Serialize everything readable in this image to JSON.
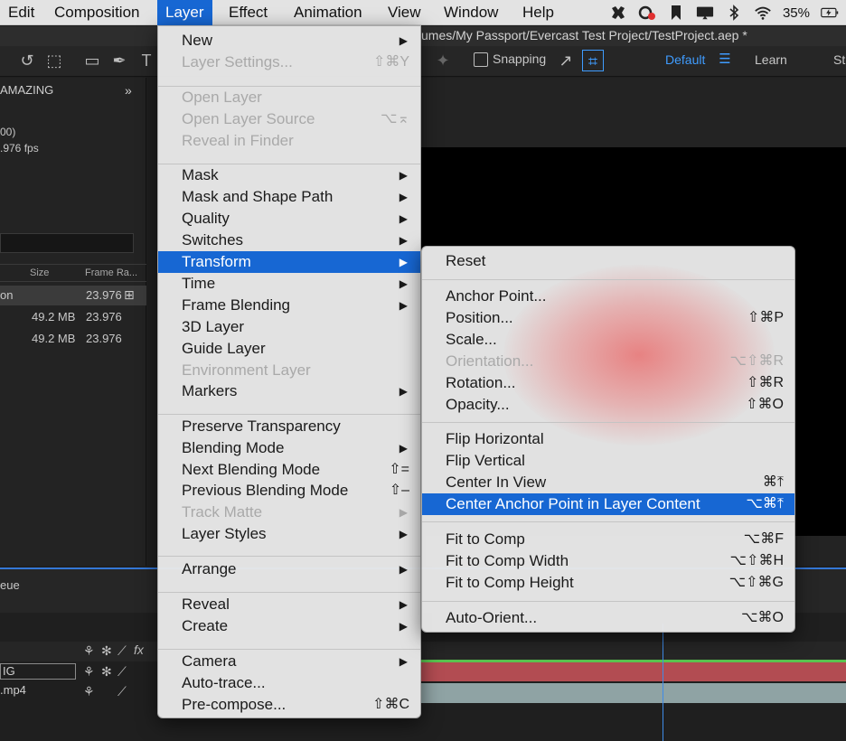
{
  "menubar": {
    "items": [
      "Edit",
      "Composition",
      "Layer",
      "Effect",
      "Animation",
      "View",
      "Window",
      "Help"
    ],
    "battery": "35%"
  },
  "toolbar": {
    "path_title": "umes/My Passport/Evercast Test Project/TestProject.aep *",
    "snapping": "Snapping",
    "workspace_default": "Default",
    "workspace_learn": "Learn",
    "workspace_st": "St"
  },
  "project": {
    "name_fragment": "AMAZING",
    "info_line1": "00)",
    "info_line2": ".976 fps",
    "col_size": "Size",
    "col_frame_rate": "Frame Ra...",
    "rows": [
      {
        "name": "on",
        "size": "",
        "fps": "23.976"
      },
      {
        "name": "",
        "size": "49.2 MB",
        "fps": "23.976"
      },
      {
        "name": "",
        "size": "49.2 MB",
        "fps": "23.976"
      }
    ]
  },
  "lower": {
    "queue_label": "eue",
    "layer1": "IG",
    "layer2": ".mp4"
  },
  "layer_menu": {
    "items": [
      {
        "label": "New",
        "shortcut": "",
        "submenu": true,
        "disabled": false,
        "highlighted": false
      },
      {
        "label": "Layer Settings...",
        "shortcut": "⇧⌘Y",
        "submenu": false,
        "disabled": true,
        "highlighted": false
      },
      {
        "label": "Open Layer",
        "shortcut": "",
        "submenu": false,
        "disabled": true,
        "highlighted": false
      },
      {
        "label": "Open Layer Source",
        "shortcut": "⌥⌅",
        "submenu": false,
        "disabled": true,
        "highlighted": false
      },
      {
        "label": "Reveal in Finder",
        "shortcut": "",
        "submenu": false,
        "disabled": true,
        "highlighted": false
      },
      {
        "label": "Mask",
        "shortcut": "",
        "submenu": true,
        "disabled": false,
        "highlighted": false
      },
      {
        "label": "Mask and Shape Path",
        "shortcut": "",
        "submenu": true,
        "disabled": false,
        "highlighted": false
      },
      {
        "label": "Quality",
        "shortcut": "",
        "submenu": true,
        "disabled": false,
        "highlighted": false
      },
      {
        "label": "Switches",
        "shortcut": "",
        "submenu": true,
        "disabled": false,
        "highlighted": false
      },
      {
        "label": "Transform",
        "shortcut": "",
        "submenu": true,
        "disabled": false,
        "highlighted": true
      },
      {
        "label": "Time",
        "shortcut": "",
        "submenu": true,
        "disabled": false,
        "highlighted": false
      },
      {
        "label": "Frame Blending",
        "shortcut": "",
        "submenu": true,
        "disabled": false,
        "highlighted": false
      },
      {
        "label": "3D Layer",
        "shortcut": "",
        "submenu": false,
        "disabled": false,
        "highlighted": false
      },
      {
        "label": "Guide Layer",
        "shortcut": "",
        "submenu": false,
        "disabled": false,
        "highlighted": false
      },
      {
        "label": "Environment Layer",
        "shortcut": "",
        "submenu": false,
        "disabled": true,
        "highlighted": false
      },
      {
        "label": "Markers",
        "shortcut": "",
        "submenu": true,
        "disabled": false,
        "highlighted": false
      },
      {
        "label": "Preserve Transparency",
        "shortcut": "",
        "submenu": false,
        "disabled": false,
        "highlighted": false
      },
      {
        "label": "Blending Mode",
        "shortcut": "",
        "submenu": true,
        "disabled": false,
        "highlighted": false
      },
      {
        "label": "Next Blending Mode",
        "shortcut": "⇧=",
        "submenu": false,
        "disabled": false,
        "highlighted": false
      },
      {
        "label": "Previous Blending Mode",
        "shortcut": "⇧–",
        "submenu": false,
        "disabled": false,
        "highlighted": false
      },
      {
        "label": "Track Matte",
        "shortcut": "",
        "submenu": true,
        "disabled": true,
        "highlighted": false
      },
      {
        "label": "Layer Styles",
        "shortcut": "",
        "submenu": true,
        "disabled": false,
        "highlighted": false
      },
      {
        "label": "Arrange",
        "shortcut": "",
        "submenu": true,
        "disabled": false,
        "highlighted": false
      },
      {
        "label": "Reveal",
        "shortcut": "",
        "submenu": true,
        "disabled": false,
        "highlighted": false
      },
      {
        "label": "Create",
        "shortcut": "",
        "submenu": true,
        "disabled": false,
        "highlighted": false
      },
      {
        "label": "Camera",
        "shortcut": "",
        "submenu": true,
        "disabled": false,
        "highlighted": false
      },
      {
        "label": "Auto-trace...",
        "shortcut": "",
        "submenu": false,
        "disabled": false,
        "highlighted": false
      },
      {
        "label": "Pre-compose...",
        "shortcut": "⇧⌘C",
        "submenu": false,
        "disabled": false,
        "highlighted": false
      }
    ]
  },
  "transform_menu": {
    "items": [
      {
        "label": "Reset",
        "shortcut": "",
        "disabled": false,
        "highlighted": false
      },
      {
        "label": "Anchor Point...",
        "shortcut": "",
        "disabled": false,
        "highlighted": false
      },
      {
        "label": "Position...",
        "shortcut": "⇧⌘P",
        "disabled": false,
        "highlighted": false
      },
      {
        "label": "Scale...",
        "shortcut": "",
        "disabled": false,
        "highlighted": false
      },
      {
        "label": "Orientation...",
        "shortcut": "⌥⇧⌘R",
        "disabled": true,
        "highlighted": false
      },
      {
        "label": "Rotation...",
        "shortcut": "⇧⌘R",
        "disabled": false,
        "highlighted": false
      },
      {
        "label": "Opacity...",
        "shortcut": "⇧⌘O",
        "disabled": false,
        "highlighted": false
      },
      {
        "label": "Flip Horizontal",
        "shortcut": "",
        "disabled": false,
        "highlighted": false
      },
      {
        "label": "Flip Vertical",
        "shortcut": "",
        "disabled": false,
        "highlighted": false
      },
      {
        "label": "Center In View",
        "shortcut": "⌘⤒",
        "disabled": false,
        "highlighted": false
      },
      {
        "label": "Center Anchor Point in Layer Content",
        "shortcut": "⌥⌘⤒",
        "disabled": false,
        "highlighted": true
      },
      {
        "label": "Fit to Comp",
        "shortcut": "⌥⌘F",
        "disabled": false,
        "highlighted": false
      },
      {
        "label": "Fit to Comp Width",
        "shortcut": "⌥⇧⌘H",
        "disabled": false,
        "highlighted": false
      },
      {
        "label": "Fit to Comp Height",
        "shortcut": "⌥⇧⌘G",
        "disabled": false,
        "highlighted": false
      },
      {
        "label": "Auto-Orient...",
        "shortcut": "⌥⌘O",
        "disabled": false,
        "highlighted": false
      }
    ]
  },
  "colors": {
    "highlight": "#1767d3",
    "menu_bg": "#e8e8e8",
    "accent_blue": "#3f9cff"
  }
}
